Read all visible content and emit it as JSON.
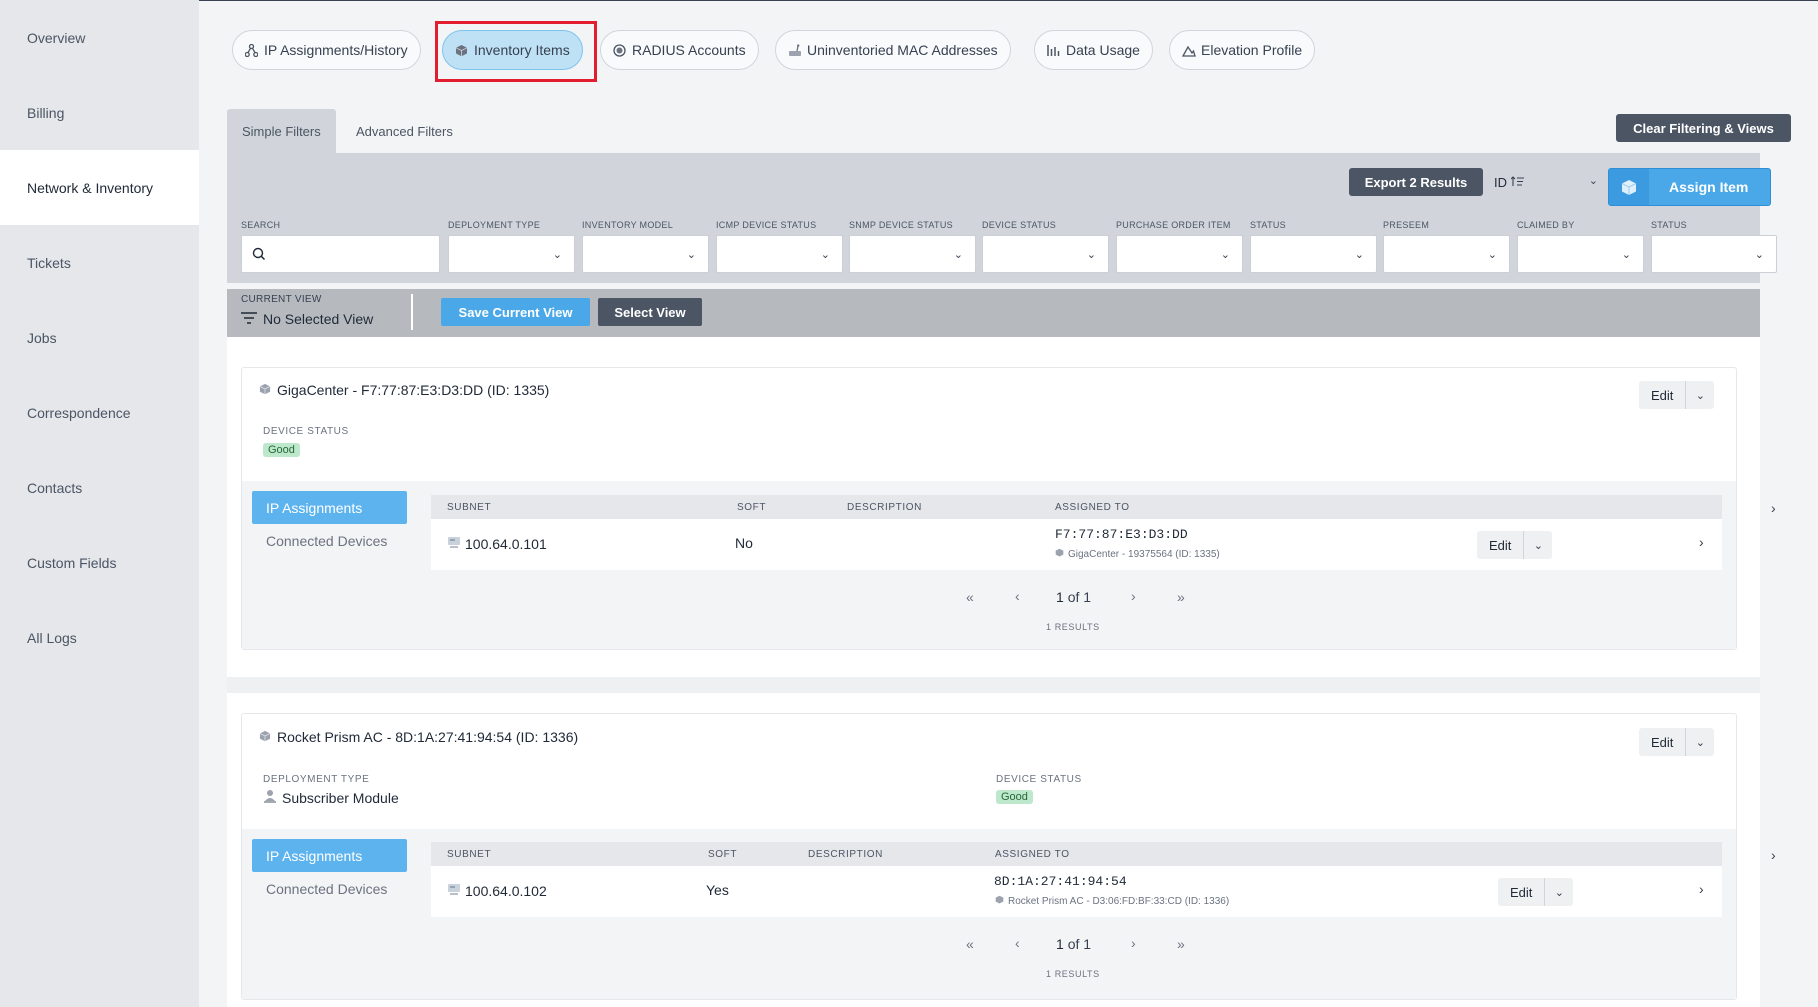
{
  "sidebar": {
    "items": [
      {
        "label": "Overview"
      },
      {
        "label": "Billing"
      },
      {
        "label": "Network & Inventory",
        "active": true
      },
      {
        "label": "Tickets"
      },
      {
        "label": "Jobs"
      },
      {
        "label": "Correspondence"
      },
      {
        "label": "Contacts"
      },
      {
        "label": "Custom Fields"
      },
      {
        "label": "All Logs"
      }
    ]
  },
  "top_tabs": [
    {
      "label": "IP Assignments/History",
      "icon": "network-icon"
    },
    {
      "label": "Inventory Items",
      "icon": "cube-icon",
      "active": true
    },
    {
      "label": "RADIUS Accounts",
      "icon": "radius-icon"
    },
    {
      "label": "Uninventoried MAC Addresses",
      "icon": "device-icon"
    },
    {
      "label": "Data Usage",
      "icon": "bar-chart-icon"
    },
    {
      "label": "Elevation Profile",
      "icon": "mountain-icon"
    }
  ],
  "filters": {
    "tabs": [
      "Simple Filters",
      "Advanced Filters"
    ],
    "clear_label": "Clear Filtering & Views",
    "export_label": "Export 2 Results",
    "sort_label": "ID",
    "assign_label": "Assign Item",
    "fields": [
      {
        "label": "SEARCH",
        "value": ""
      },
      {
        "label": "DEPLOYMENT TYPE",
        "value": ""
      },
      {
        "label": "INVENTORY MODEL",
        "value": ""
      },
      {
        "label": "ICMP DEVICE STATUS",
        "value": ""
      },
      {
        "label": "SNMP DEVICE STATUS",
        "value": ""
      },
      {
        "label": "DEVICE STATUS",
        "value": ""
      },
      {
        "label": "PURCHASE ORDER ITEM",
        "value": ""
      },
      {
        "label": "STATUS",
        "value": ""
      },
      {
        "label": "PRESEEM",
        "value": ""
      },
      {
        "label": "CLAIMED BY",
        "value": ""
      },
      {
        "label": "STATUS",
        "value": ""
      }
    ],
    "current_view_label": "CURRENT VIEW",
    "current_view_value": "No Selected View",
    "save_view_label": "Save Current View",
    "select_view_label": "Select View"
  },
  "items": [
    {
      "title": "GigaCenter - F7:77:87:E3:D3:DD (ID: 1335)",
      "device_status_label": "DEVICE STATUS",
      "device_status": "Good",
      "edit_label": "Edit",
      "subtabs": [
        "IP Assignments",
        "Connected Devices"
      ],
      "table": {
        "headers": [
          "SUBNET",
          "SOFT",
          "DESCRIPTION",
          "ASSIGNED TO"
        ],
        "rows": [
          {
            "subnet": "100.64.0.101",
            "soft": "No",
            "description": "",
            "assigned_to": "F7:77:87:E3:D3:DD",
            "assigned_sub": "GigaCenter - 19375564 (ID: 1335)",
            "edit_label": "Edit"
          }
        ]
      },
      "pager": {
        "first": "«",
        "prev": "‹",
        "page": "1",
        "of": "of 1",
        "next": "›",
        "last": "»",
        "results": "1 RESULTS"
      }
    },
    {
      "title": "Rocket Prism AC - 8D:1A:27:41:94:54 (ID: 1336)",
      "deployment_type_label": "DEPLOYMENT TYPE",
      "deployment_type": "Subscriber Module",
      "device_status_label": "DEVICE STATUS",
      "device_status": "Good",
      "edit_label": "Edit",
      "subtabs": [
        "IP Assignments",
        "Connected Devices"
      ],
      "table": {
        "headers": [
          "SUBNET",
          "SOFT",
          "DESCRIPTION",
          "ASSIGNED TO"
        ],
        "rows": [
          {
            "subnet": "100.64.0.102",
            "soft": "Yes",
            "description": "",
            "assigned_to": "8D:1A:27:41:94:54",
            "assigned_sub": "Rocket Prism AC - D3:06:FD:BF:33:CD (ID: 1336)",
            "edit_label": "Edit"
          }
        ]
      },
      "pager": {
        "first": "«",
        "prev": "‹",
        "page": "1",
        "of": "of 1",
        "next": "›",
        "last": "»",
        "results": "1 RESULTS"
      }
    }
  ],
  "colors": {
    "accent": "#4aa8e8",
    "dark_button": "#4b5563",
    "highlight": "#e11d2f",
    "good_badge": "#bde8cc"
  }
}
